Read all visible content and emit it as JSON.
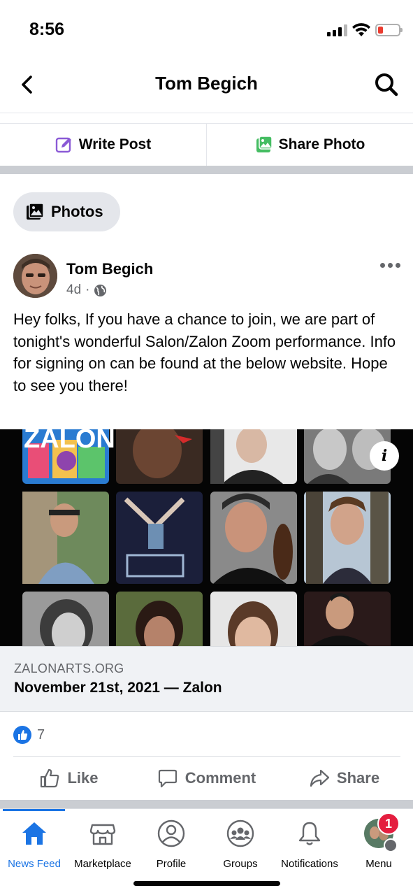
{
  "status_bar": {
    "time": "8:56"
  },
  "header": {
    "title": "Tom Begich"
  },
  "composer": {
    "write_post": "Write Post",
    "share_photo": "Share Photo"
  },
  "photos_chip": {
    "label": "Photos"
  },
  "post": {
    "author": "Tom Begich",
    "time_ago": "4d",
    "separator": "·",
    "text": "Hey folks, If you have a chance to join, we are part of tonight's wonderful Salon/Zalon Zoom performance. Info for signing on can be found at the below website. Hope to see you there!",
    "image_banner_text": "ZALON",
    "link": {
      "domain": "ZALONARTS.ORG",
      "title": "November 21st, 2021 — Zalon"
    },
    "reaction_count": "7"
  },
  "actions": {
    "like": "Like",
    "comment": "Comment",
    "share": "Share"
  },
  "tabbar": {
    "tabs": [
      {
        "label": "News Feed",
        "icon": "home-icon",
        "active": true
      },
      {
        "label": "Marketplace",
        "icon": "marketplace-icon"
      },
      {
        "label": "Profile",
        "icon": "profile-icon"
      },
      {
        "label": "Groups",
        "icon": "groups-icon"
      },
      {
        "label": "Notifications",
        "icon": "bell-icon"
      },
      {
        "label": "Menu",
        "icon": "menu-avatar-icon"
      }
    ],
    "menu_badge": "1"
  },
  "colors": {
    "accent": "#1b74e4",
    "badge": "#e41e3f",
    "secondary_text": "#65676b",
    "divider": "#cacdd2"
  }
}
